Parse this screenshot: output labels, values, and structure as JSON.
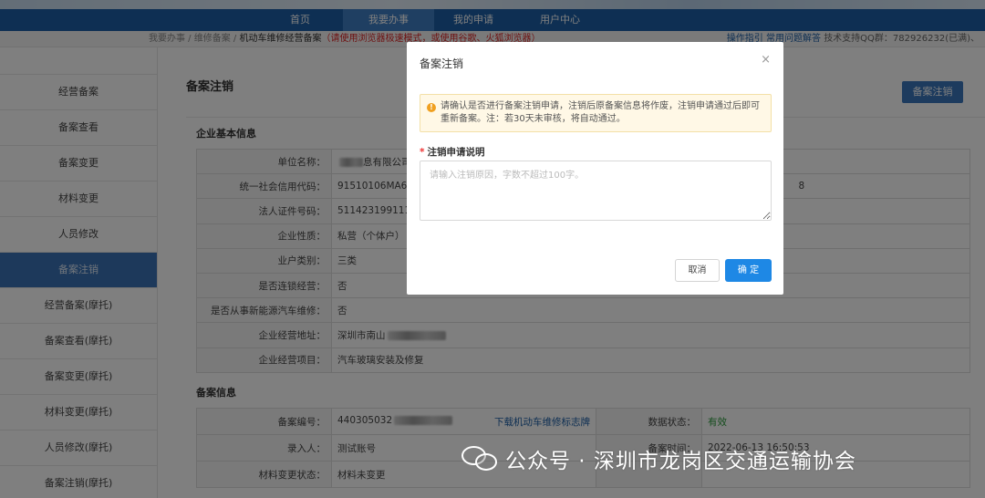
{
  "nav": {
    "items": [
      "首页",
      "我要办事",
      "我的申请",
      "用户中心"
    ],
    "active_index": 1
  },
  "breadcrumb": {
    "home": "我要办事",
    "sep": " / ",
    "level2": "维修备案",
    "current": "机动车维修经营备案",
    "warning": "（请使用浏览器极速模式，或使用谷歌、火狐浏览器）",
    "help_links": "操作指引  常用问题解答",
    "support": "技术支持QQ群：782926232(已满)、"
  },
  "sidebar": {
    "items": [
      "经营备案",
      "备案查看",
      "备案变更",
      "材料变更",
      "人员修改",
      "备案注销",
      "经营备案(摩托)",
      "备案查看(摩托)",
      "备案变更(摩托)",
      "材料变更(摩托)",
      "人员修改(摩托)",
      "备案注销(摩托)"
    ],
    "active": "备案注销"
  },
  "main": {
    "title": "备案注销",
    "action_button": "备案注销",
    "section_basic": "企业基本信息",
    "basic_rows": [
      {
        "label": "单位名称：",
        "value": "息有限公司"
      },
      {
        "label": "统一社会信用代码：",
        "value": "91510106MA61",
        "extra": "8"
      },
      {
        "label": "法人证件号码：",
        "value": "51142319911102"
      },
      {
        "label": "企业性质：",
        "value": "私营（个体户）"
      },
      {
        "label": "业户类别：",
        "value": "三类"
      },
      {
        "label": "是否连锁经营：",
        "value": "否"
      },
      {
        "label": "是否从事新能源汽车维修：",
        "value": "否"
      },
      {
        "label": "企业经营地址：",
        "value": "深圳市南山"
      },
      {
        "label": "企业经营项目：",
        "value": "汽车玻璃安装及修复"
      }
    ],
    "section_record": "备案信息",
    "record_rows": [
      {
        "label": "备案编号：",
        "value": "440305032",
        "link": "下载机动车维修标志牌",
        "label2": "数据状态：",
        "value2": "有效"
      },
      {
        "label": "录入人：",
        "value": "测试账号",
        "link": "",
        "label2": "备案时间：",
        "value2": "2022-06-13 16:50:53"
      },
      {
        "label": "材料变更状态：",
        "value": "材料未变更",
        "link": "",
        "label2": "",
        "value2": ""
      }
    ]
  },
  "modal": {
    "title": "备案注销",
    "close": "×",
    "alert_icon": "!",
    "alert": "请确认是否进行备案注销申请，注销后原备案信息将作废，注销申请通过后即可重新备案。注：若30天未审核，将自动通过。",
    "field_label": "注销申请说明",
    "required_mark": "*",
    "placeholder": "请输入注销原因，字数不超过100字。",
    "cancel": "取消",
    "confirm": "确 定"
  },
  "watermark": {
    "text": "公众号 · 深圳市龙岗区交通运输协会"
  },
  "colors": {
    "nav_bg": "#1c5fa6",
    "sidebar_active": "#3a73b6",
    "primary_button": "#1e88e5",
    "alert_bg": "#fff8e6",
    "status_ok": "#2a9a3a"
  }
}
